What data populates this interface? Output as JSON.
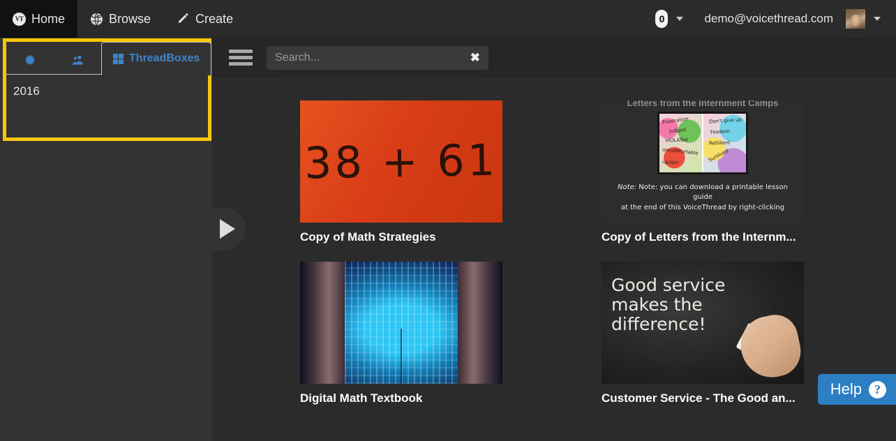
{
  "topnav": {
    "items": [
      {
        "label": "Home",
        "icon": "voicethread-logo-icon",
        "active": true
      },
      {
        "label": "Browse",
        "icon": "globe-icon",
        "active": false
      },
      {
        "label": "Create",
        "icon": "pencil-icon",
        "active": false
      }
    ],
    "notification_count": "0",
    "user_email": "demo@voicethread.com",
    "avatar_alt": "user-avatar",
    "accent_active_bg": "#111111"
  },
  "sidebar": {
    "highlight_color": "#f5c60c",
    "tabs": [
      {
        "label": "",
        "icon": "snowflake-icon",
        "active": false
      },
      {
        "label": "",
        "icon": "people-icon",
        "active": false
      },
      {
        "label": "ThreadBoxes",
        "icon": "grid-squares-icon",
        "active": true
      }
    ],
    "items": [
      {
        "label": "2016"
      }
    ],
    "handle_icon": "play-triangle-icon"
  },
  "toolbar": {
    "menu_icon": "hamburger-menu-icon",
    "search_placeholder": "Search...",
    "search_value": "",
    "clear_icon": "✖"
  },
  "content": {
    "cards": [
      {
        "title": "Copy of Math Strategies",
        "thumb": "math-equation-orange",
        "thumb_text": "38 + 61"
      },
      {
        "title": "Copy of Letters from the Internm...",
        "thumb": "letters-internment-slide",
        "slide_title": "Letters from the Internment Camps",
        "note_line1": "Note: you can download a printable lesson guide",
        "note_line2": "at the end of this VoiceThread by right-clicking",
        "art_words_left": [
          "Frustration",
          "Judged",
          "VIOLATed",
          "uncoMFortable",
          "racism"
        ],
        "art_words_right": [
          "Don't give up",
          "Feedom",
          "ReSilient",
          "SurVived"
        ]
      },
      {
        "title": "Digital Math Textbook",
        "thumb": "blue-circuit-book"
      },
      {
        "title": "Customer Service - The Good an...",
        "thumb": "chalkboard-good-service",
        "chalk_line1": "Good service",
        "chalk_line2": "makes the",
        "chalk_line3": "difference!"
      }
    ]
  },
  "help": {
    "label": "Help",
    "icon": "question-mark-icon",
    "color": "#2c7fc4"
  }
}
